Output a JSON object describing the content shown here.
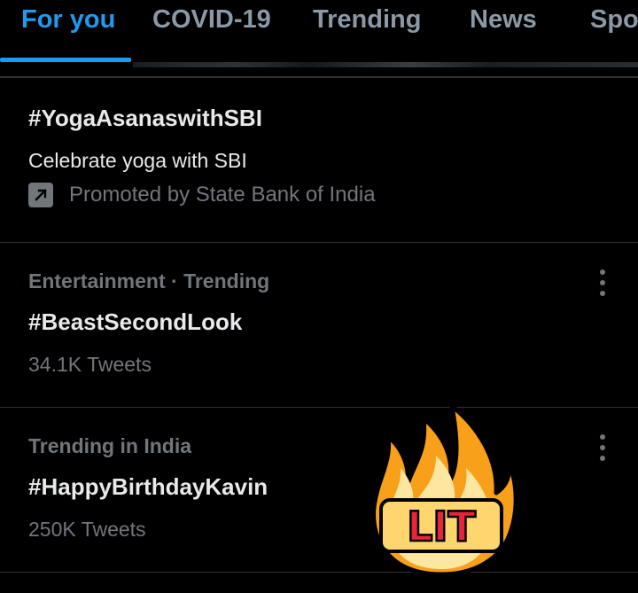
{
  "tabs": [
    {
      "label": "For you",
      "active": true
    },
    {
      "label": "COVID-19",
      "active": false
    },
    {
      "label": "Trending",
      "active": false
    },
    {
      "label": "News",
      "active": false
    },
    {
      "label": "Spo",
      "active": false
    }
  ],
  "trends": [
    {
      "hashtag": "#YogaAsanaswithSBI",
      "description": "Celebrate yoga with SBI",
      "promoted_by": "Promoted by State Bank of India",
      "icon": "external-arrow-icon"
    },
    {
      "category": "Entertainment · Trending",
      "hashtag": "#BeastSecondLook",
      "count": "34.1K Tweets"
    },
    {
      "category": "Trending in India",
      "hashtag": "#HappyBirthdayKavin",
      "count": "250K Tweets"
    }
  ],
  "sticker": {
    "text": "LIT",
    "icon": "fire-icon"
  },
  "colors": {
    "accent": "#1d9bf0",
    "background": "#000000",
    "muted": "#71767b",
    "text": "#e7e9ea",
    "divider": "#2f3336"
  }
}
